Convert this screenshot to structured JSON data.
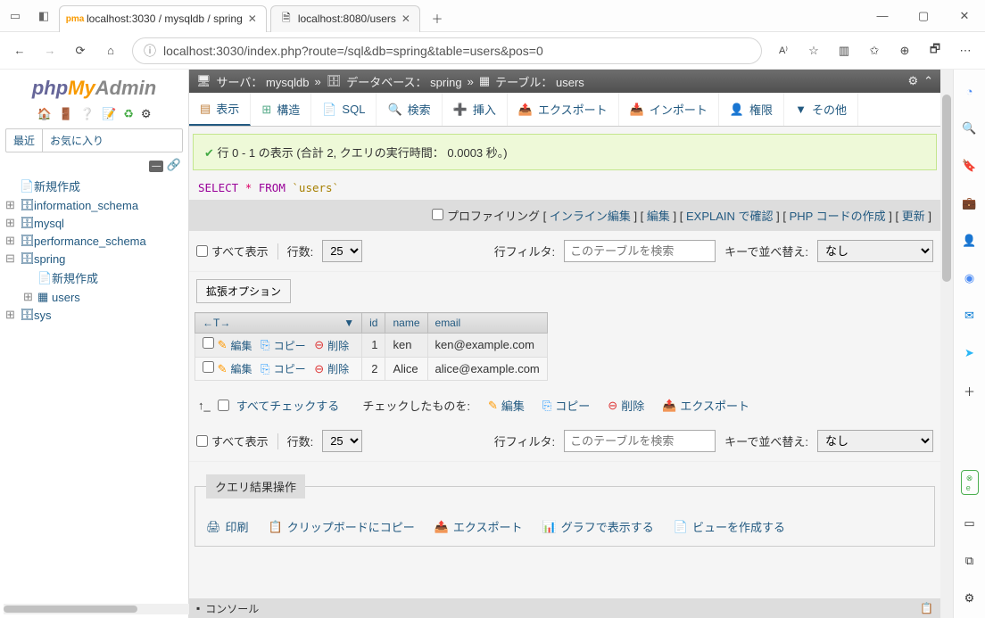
{
  "browser": {
    "tab1_title": "localhost:3030 / mysqldb / spring",
    "tab2_title": "localhost:8080/users",
    "url": "localhost:3030/index.php?route=/sql&db=spring&table=users&pos=0"
  },
  "pma": {
    "logo_php": "php",
    "logo_my": "My",
    "logo_admin": "Admin",
    "recent": "最近",
    "favorite": "お気に入り"
  },
  "tree": {
    "new": "新規作成",
    "information_schema": "information_schema",
    "mysql": "mysql",
    "performance_schema": "performance_schema",
    "spring": "spring",
    "spring_new": "新規作成",
    "spring_users": "users",
    "sys": "sys"
  },
  "breadcrumb": {
    "server_label": "サーバ：",
    "server": "mysqldb",
    "sep": "»",
    "db_label": "データベース：",
    "db": "spring",
    "table_label": "テーブル：",
    "table": "users"
  },
  "tabs": {
    "browse": "表示",
    "structure": "構造",
    "sql": "SQL",
    "search": "検索",
    "insert": "挿入",
    "export": "エクスポート",
    "import": "インポート",
    "privileges": "権限",
    "more": "その他"
  },
  "success": "行 0 - 1 の表示 (合計 2, クエリの実行時間： 0.0003 秒。)",
  "sql": {
    "select": "SELECT",
    "star": "*",
    "from": "FROM",
    "table": "`users`"
  },
  "options": {
    "profiling": "プロファイリング",
    "inline": "インライン編集",
    "edit": "編集",
    "explain": "EXPLAIN で確認",
    "phpcode": "PHP コードの作成",
    "update": "更新"
  },
  "filter": {
    "showall": "すべて表示",
    "rows_label": "行数:",
    "rows_value": "25",
    "filter_label": "行フィルタ:",
    "filter_placeholder": "このテーブルを検索",
    "sort_label": "キーで並べ替え:",
    "sort_value": "なし"
  },
  "ext_options": "拡張オプション",
  "cols": {
    "t": "←T→",
    "id": "id",
    "name": "name",
    "email": "email"
  },
  "rowactions": {
    "edit": "編集",
    "copy": "コピー",
    "delete": "削除"
  },
  "rows": [
    {
      "id": "1",
      "name": "ken",
      "email": "ken@example.com"
    },
    {
      "id": "2",
      "name": "Alice",
      "email": "alice@example.com"
    }
  ],
  "checkall": {
    "label": "すべてチェックする",
    "withselected": "チェックしたものを:",
    "edit": "編集",
    "copy": "コピー",
    "delete": "削除",
    "export": "エクスポート"
  },
  "queryops": {
    "legend": "クエリ結果操作",
    "print": "印刷",
    "clipboard": "クリップボードにコピー",
    "export": "エクスポート",
    "chart": "グラフで表示する",
    "view": "ビューを作成する"
  },
  "console": "コンソール"
}
